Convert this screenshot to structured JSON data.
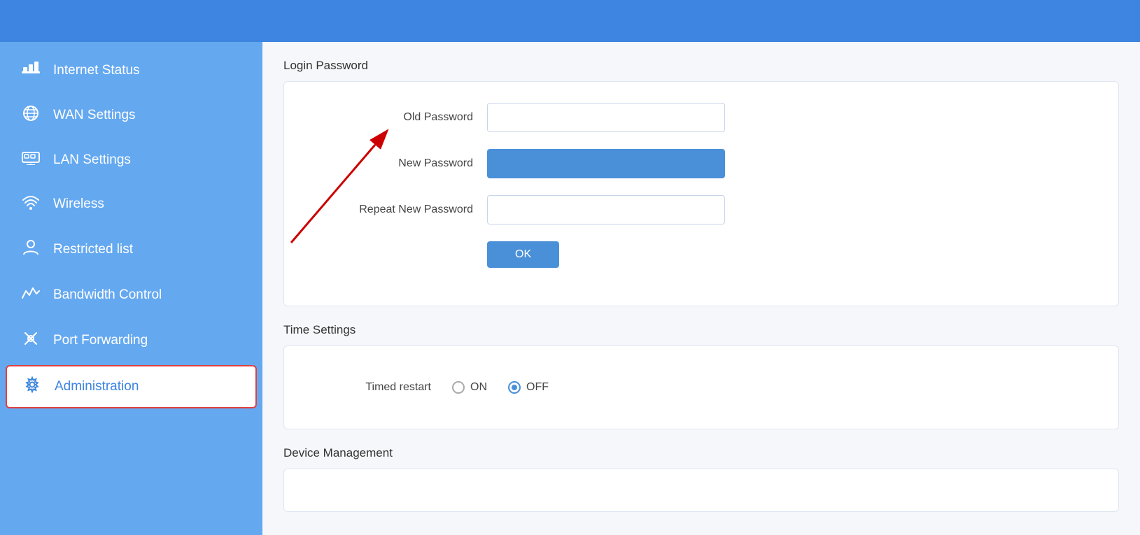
{
  "topbar": {
    "bg_color": "#3d85e0"
  },
  "sidebar": {
    "items": [
      {
        "id": "internet-status",
        "label": "Internet Status",
        "icon": "⊟",
        "active": false
      },
      {
        "id": "wan-settings",
        "label": "WAN Settings",
        "icon": "⊕",
        "active": false
      },
      {
        "id": "lan-settings",
        "label": "LAN Settings",
        "icon": "▣",
        "active": false
      },
      {
        "id": "wireless",
        "label": "Wireless",
        "icon": "((·))",
        "active": false
      },
      {
        "id": "restricted-list",
        "label": "Restricted list",
        "icon": "👤",
        "active": false
      },
      {
        "id": "bandwidth-control",
        "label": "Bandwidth Control",
        "icon": "∿",
        "active": false
      },
      {
        "id": "port-forwarding",
        "label": "Port Forwarding",
        "icon": "⚙",
        "active": false
      },
      {
        "id": "administration",
        "label": "Administration",
        "icon": "⚙",
        "active": true
      }
    ]
  },
  "content": {
    "login_password_section": {
      "title": "Login Password",
      "old_password_label": "Old Password",
      "old_password_value": "••••",
      "new_password_label": "New Password",
      "new_password_value": "••••••••••",
      "repeat_password_label": "Repeat New Password",
      "repeat_password_value": "••••••••••",
      "ok_button_label": "OK"
    },
    "time_settings_section": {
      "title": "Time Settings",
      "timed_restart_label": "Timed restart",
      "on_label": "ON",
      "off_label": "OFF"
    },
    "device_management_section": {
      "title": "Device Management"
    }
  }
}
